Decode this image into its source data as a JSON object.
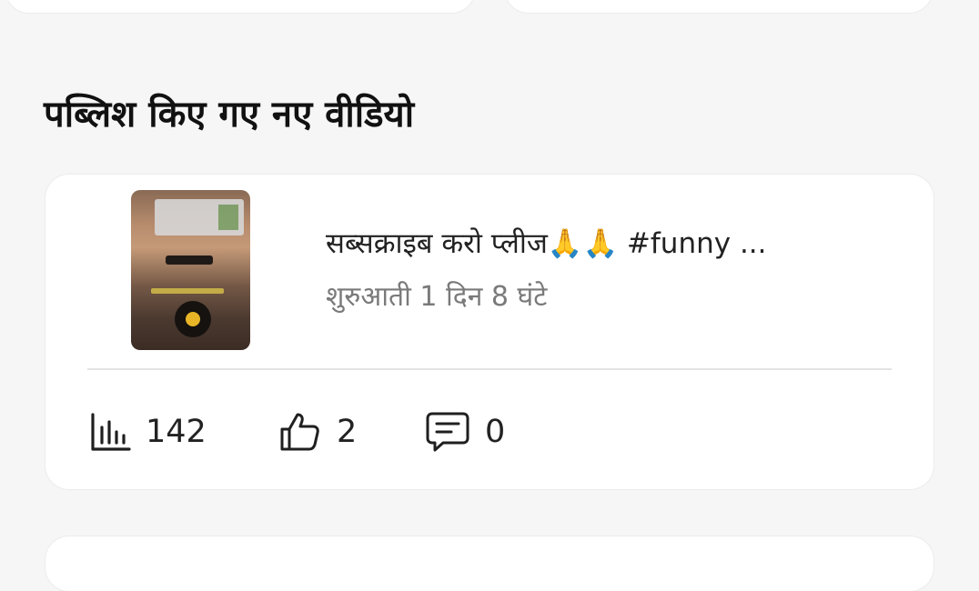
{
  "section": {
    "title": "पब्लिश किए गए नए वीडियो"
  },
  "video": {
    "title": "सब्सक्राइब करो प्लीज🙏🙏 #funny ...",
    "time": "शुरुआती 1 दिन 8 घंटे",
    "stats": {
      "views": "142",
      "likes": "2",
      "comments": "0"
    }
  },
  "icons": {
    "views": "bar-chart-icon",
    "likes": "thumbs-up-icon",
    "comments": "comment-icon"
  },
  "colors": {
    "background": "#f6f6f6",
    "card": "#ffffff",
    "title": "#111111",
    "secondary_text": "#7a7a7a",
    "divider": "#e3e3e3"
  }
}
